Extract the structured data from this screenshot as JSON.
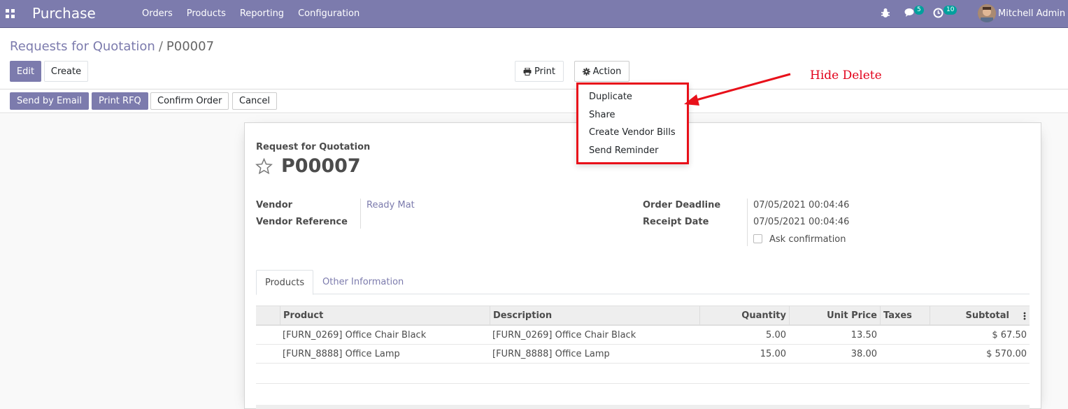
{
  "navbar": {
    "app_title": "Purchase",
    "menu": [
      "Orders",
      "Products",
      "Reporting",
      "Configuration"
    ],
    "chat_count": "5",
    "activity_count": "10",
    "user_name": "Mitchell Admin",
    "bg_color": "#7c7bad"
  },
  "breadcrumb": {
    "parent": "Requests for Quotation",
    "separator": "/",
    "current": "P00007"
  },
  "control_panel": {
    "edit_label": "Edit",
    "create_label": "Create",
    "print_label": "Print",
    "action_label": "Action"
  },
  "statusbar": {
    "send_email_label": "Send by Email",
    "print_rfq_label": "Print RFQ",
    "confirm_label": "Confirm Order",
    "cancel_label": "Cancel"
  },
  "action_menu": {
    "items": [
      "Duplicate",
      "Share",
      "Create Vendor Bills",
      "Send Reminder"
    ]
  },
  "annotation": {
    "text": "Hide Delete",
    "color": "#e2001a"
  },
  "form": {
    "doc_label": "Request for Quotation",
    "doc_name": "P00007",
    "vendor_label": "Vendor",
    "vendor_value": "Ready Mat",
    "vendor_ref_label": "Vendor Reference",
    "vendor_ref_value": "",
    "deadline_label": "Order Deadline",
    "deadline_value": "07/05/2021 00:04:46",
    "receipt_label": "Receipt Date",
    "receipt_value": "07/05/2021 00:04:46",
    "ask_confirmation_label": "Ask confirmation",
    "ask_confirmation_checked": false
  },
  "tabs": [
    "Products",
    "Other Information"
  ],
  "order_lines": {
    "columns": [
      "Product",
      "Description",
      "Quantity",
      "Unit Price",
      "Taxes",
      "Subtotal"
    ],
    "rows": [
      {
        "product": "[FURN_0269] Office Chair Black",
        "description": "[FURN_0269] Office Chair Black",
        "quantity": "5.00",
        "unit_price": "13.50",
        "taxes": "",
        "subtotal": "$ 67.50"
      },
      {
        "product": "[FURN_8888] Office Lamp",
        "description": "[FURN_8888] Office Lamp",
        "quantity": "15.00",
        "unit_price": "38.00",
        "taxes": "",
        "subtotal": "$ 570.00"
      }
    ]
  }
}
